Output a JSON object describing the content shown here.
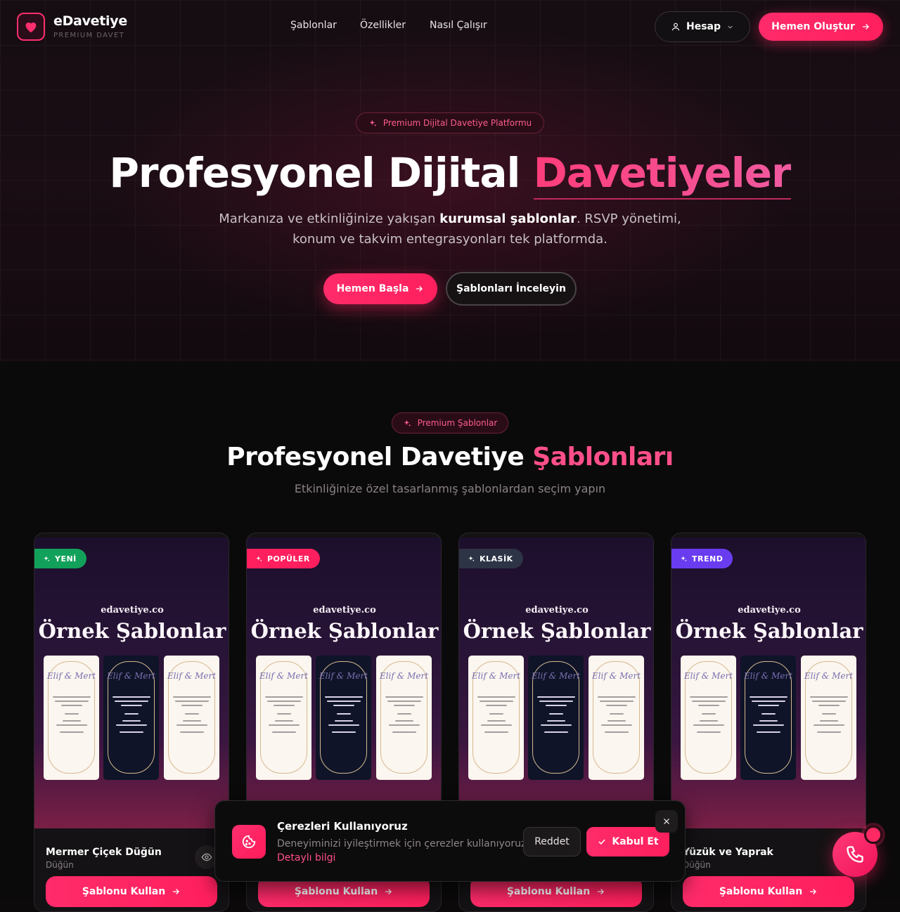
{
  "header": {
    "brand": "eDavetiye",
    "brand_sub": "PREMIUM DAVET",
    "nav": [
      "Şablonlar",
      "Özellikler",
      "Nasıl Çalışır"
    ],
    "account_label": "Hesap",
    "cta_label": "Hemen Oluştur"
  },
  "hero": {
    "pill": "Premium Dijital Davetiye Platformu",
    "title_main": "Profesyonel Dijital ",
    "title_accent": "Davetiyeler",
    "sub_before": "Markanıza ve etkinliğinize yakışan ",
    "sub_bold": "kurumsal şablonlar",
    "sub_after": ". RSVP yönetimi, konum ve takvim entegrasyonları tek platformda.",
    "start_label": "Hemen Başla",
    "browse_label": "Şablonları İnceleyin"
  },
  "templates_section": {
    "pill": "Premium Şablonlar",
    "title_main": "Profesyonel Davetiye ",
    "title_accent": "Şablonları",
    "subtitle": "Etkinliğinize özel tasarlanmış şablonlardan seçim yapın"
  },
  "cards": [
    {
      "badge": "YENİ",
      "badge_color": "#12a15a",
      "site": "edavetiye.co",
      "sample": "Örnek Şablonlar",
      "mini_names": "Elif & Mert",
      "name": "Mermer Çiçek Düğün",
      "category": "Düğün",
      "use_label": "Şablonu Kullan"
    },
    {
      "badge": "POPÜLER",
      "badge_color": "#ff1f5e",
      "site": "edavetiye.co",
      "sample": "Örnek Şablonlar",
      "mini_names": "Elif & Mert",
      "name": "",
      "category": "",
      "use_label": "Şablonu Kullan"
    },
    {
      "badge": "KLASİK",
      "badge_color": "#2c3445",
      "site": "edavetiye.co",
      "sample": "Örnek Şablonlar",
      "mini_names": "Elif & Mert",
      "name": "",
      "category": "",
      "use_label": "Şablonu Kullan"
    },
    {
      "badge": "TREND",
      "badge_color": "#6a3cf0",
      "site": "edavetiye.co",
      "sample": "Örnek Şablonlar",
      "mini_names": "Elif & Mert",
      "name": "Yüzük ve Yaprak",
      "category": "Düğün",
      "use_label": "Şablonu Kullan"
    }
  ],
  "cookie": {
    "title": "Çerezleri Kullanıyoruz",
    "text": "Deneyiminizi iyileştirmek için çerezler kullanıyoruz.",
    "link": "Detaylı bilgi",
    "reject_label": "Reddet",
    "accept_label": "Kabul Et"
  },
  "icons": {
    "logo": "heart-icon",
    "account": "user-icon",
    "sparkle": "sparkles-icon",
    "arrow": "arrow-right-icon",
    "eye": "eye-icon",
    "cookie": "cookie-icon",
    "check": "check-icon",
    "close": "close-icon",
    "phone": "phone-icon"
  },
  "colors": {
    "accent": "#ff2b6a",
    "background": "#0c0a0b"
  }
}
